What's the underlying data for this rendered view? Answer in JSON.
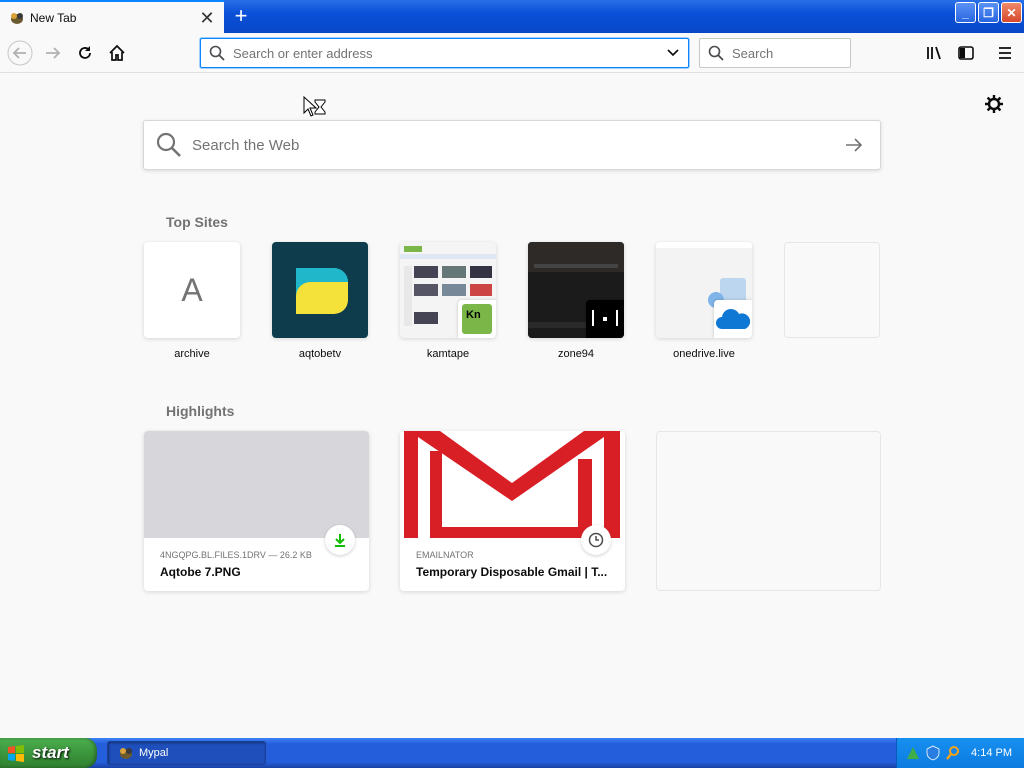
{
  "tab": {
    "title": "New Tab",
    "close_icon": "close-icon"
  },
  "newtab": {
    "label": "+"
  },
  "urlbar": {
    "placeholder": "Search or enter address"
  },
  "searchbar": {
    "placeholder": "Search"
  },
  "web_search": {
    "placeholder": "Search the Web"
  },
  "sections": {
    "top_sites": "Top Sites",
    "highlights": "Highlights"
  },
  "top_sites": [
    {
      "label": "archive",
      "letter": "A"
    },
    {
      "label": "aqtobetv"
    },
    {
      "label": "kamtape"
    },
    {
      "label": "zone94"
    },
    {
      "label": "onedrive.live"
    },
    {
      "label": ""
    }
  ],
  "highlights": [
    {
      "meta": "4NGQPG.BL.FILES.1DRV — 26.2 KB",
      "title": "Aqtobe 7.PNG",
      "badge_icon": "download-icon"
    },
    {
      "meta": "EMAILNATOR",
      "title": "Temporary Disposable Gmail | T...",
      "badge_icon": "clock-icon"
    },
    {
      "meta": "",
      "title": ""
    }
  ],
  "taskbar": {
    "start_label": "start",
    "task_label": "Mypal",
    "clock": "4:14 PM"
  },
  "colors": {
    "accent": "#0a84ff",
    "taskbar": "#245edb",
    "start": "#3c963c"
  }
}
